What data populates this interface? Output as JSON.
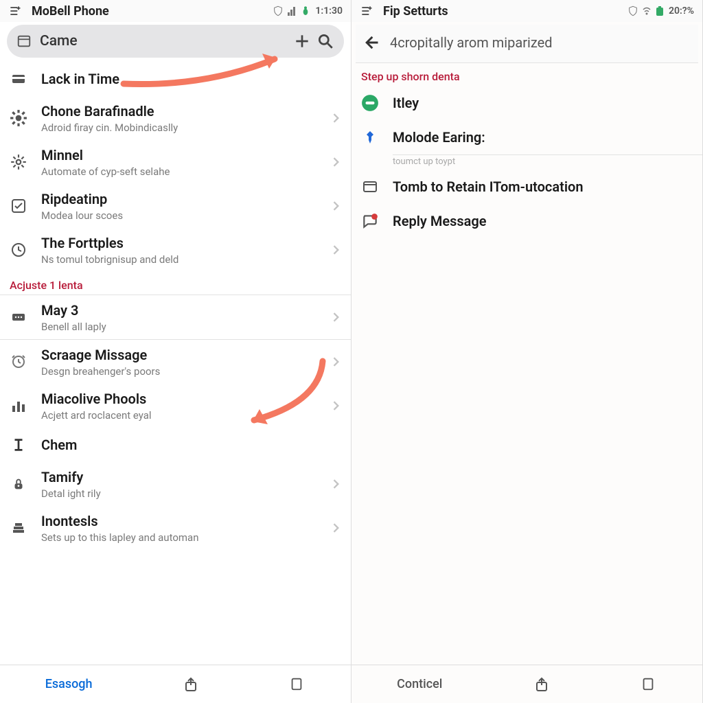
{
  "left": {
    "status": {
      "title": "MoBell Phone",
      "time": "1:1:30"
    },
    "search": {
      "text": "Came"
    },
    "items": [
      {
        "icon": "card",
        "title": "Lack in Time",
        "sub": "",
        "chev": false
      },
      {
        "icon": "gear",
        "title": "Chone Barafinadle",
        "sub": "Adroid firay cin. Mobindicaslly",
        "chev": true
      },
      {
        "icon": "gear2",
        "title": "Minnel",
        "sub": "Automate of cyp-seft selahe",
        "chev": true
      },
      {
        "icon": "check",
        "title": "Ripdeatinp",
        "sub": "Modea lour scoes",
        "chev": true
      },
      {
        "icon": "clock",
        "title": "The Forttples",
        "sub": "Ns tomul tobrignisup and deld",
        "chev": true
      }
    ],
    "section1": "Acjuste 1 lenta",
    "items2": [
      {
        "icon": "dots",
        "title": "May 3",
        "sub": "Benell all laply",
        "chev": true
      }
    ],
    "items3": [
      {
        "icon": "clock2",
        "title": "Scraage Missage",
        "sub": "Desgn breahenger's poors",
        "chev": true
      },
      {
        "icon": "bars",
        "title": "Miacolive Phools",
        "sub": "Acjett ard roclacent eyal",
        "chev": true
      },
      {
        "icon": "ibeam",
        "title": "Chem",
        "sub": "",
        "chev": false
      },
      {
        "icon": "lock",
        "title": "Tamify",
        "sub": "Detal ight rily",
        "chev": true
      },
      {
        "icon": "stack",
        "title": "Inontesls",
        "sub": "Sets up to this lapley and automan",
        "chev": true
      }
    ],
    "bottom": {
      "label": "Esasogh"
    }
  },
  "right": {
    "status": {
      "title": "Fip Setturts",
      "batt": "20:?%"
    },
    "back": {
      "title": "4cropitally arom miparized"
    },
    "section": "Step up shorn denta",
    "items": [
      {
        "icon": "green",
        "title": "Itley"
      },
      {
        "icon": "bluepin",
        "title": "Molode Earing:"
      }
    ],
    "faint": "toumct up toypt",
    "items2": [
      {
        "icon": "folder",
        "title": "Tomb to Retain ITom-utocation"
      },
      {
        "icon": "chat",
        "title": "Reply Message"
      }
    ],
    "bottom": {
      "label": "Conticel"
    }
  }
}
